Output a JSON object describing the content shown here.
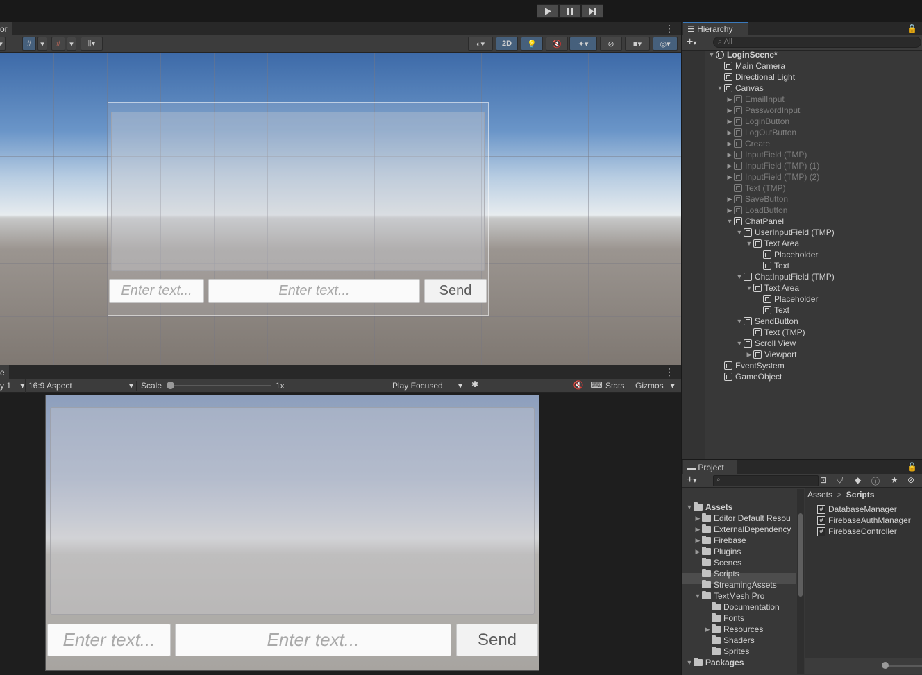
{
  "scene_tab": {
    "label": "or"
  },
  "game_tab": {
    "label": "e"
  },
  "top": {
    "play": "▶",
    "pause": "❚❚",
    "step": "▶❚"
  },
  "scene_toolbar": {
    "mode_2d": "2D"
  },
  "game_toolbar": {
    "display": "y 1",
    "aspect": "16:9 Aspect",
    "scale_label": "Scale",
    "scale_value": "1x",
    "play_mode": "Play Focused",
    "stats": "Stats",
    "gizmos": "Gizmos"
  },
  "ui_preview": {
    "placeholder_1": "Enter text...",
    "placeholder_2": "Enter text...",
    "send": "Send"
  },
  "hierarchy": {
    "title": "Hierarchy",
    "search_placeholder": "All",
    "scene": "LoginScene*",
    "items": [
      {
        "label": "Main Camera"
      },
      {
        "label": "Directional Light"
      },
      {
        "label": "Canvas"
      },
      {
        "label": "EmailInput"
      },
      {
        "label": "PasswordInput"
      },
      {
        "label": "LoginButton"
      },
      {
        "label": "LogOutButton"
      },
      {
        "label": "Create"
      },
      {
        "label": "InputField (TMP)"
      },
      {
        "label": "InputField (TMP) (1)"
      },
      {
        "label": "InputField (TMP) (2)"
      },
      {
        "label": "Text (TMP)"
      },
      {
        "label": "SaveButton"
      },
      {
        "label": "LoadButton"
      },
      {
        "label": "ChatPanel"
      },
      {
        "label": "UserInputField (TMP)"
      },
      {
        "label": "Text Area"
      },
      {
        "label": "Placeholder"
      },
      {
        "label": "Text"
      },
      {
        "label": "ChatInputField (TMP)"
      },
      {
        "label": "Text Area"
      },
      {
        "label": "Placeholder"
      },
      {
        "label": "Text"
      },
      {
        "label": "SendButton"
      },
      {
        "label": "Text (TMP)"
      },
      {
        "label": "Scroll View"
      },
      {
        "label": "Viewport"
      },
      {
        "label": "EventSystem"
      },
      {
        "label": "GameObject"
      }
    ]
  },
  "project": {
    "title": "Project",
    "breadcrumb_root": "Assets",
    "breadcrumb_sep": ">",
    "breadcrumb_current": "Scripts",
    "tree": [
      {
        "label": "Assets"
      },
      {
        "label": "Editor Default Resou"
      },
      {
        "label": "ExternalDependency"
      },
      {
        "label": "Firebase"
      },
      {
        "label": "Plugins"
      },
      {
        "label": "Scenes"
      },
      {
        "label": "Scripts"
      },
      {
        "label": "StreamingAssets"
      },
      {
        "label": "TextMesh Pro"
      },
      {
        "label": "Documentation"
      },
      {
        "label": "Fonts"
      },
      {
        "label": "Resources"
      },
      {
        "label": "Shaders"
      },
      {
        "label": "Sprites"
      },
      {
        "label": "Packages"
      }
    ],
    "files": [
      {
        "label": "DatabaseManager"
      },
      {
        "label": "FirebaseAuthManager"
      },
      {
        "label": "FirebaseController"
      }
    ]
  }
}
